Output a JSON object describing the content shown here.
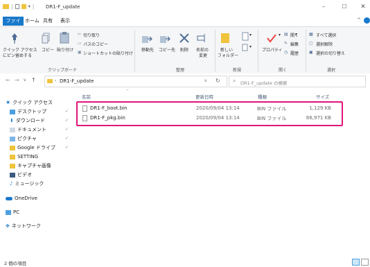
{
  "window": {
    "title": "DR1-F_update"
  },
  "ribbon_tabs": [
    "ファイル",
    "ホーム",
    "共有",
    "表示"
  ],
  "ribbon": {
    "clipboard": {
      "pin_label_1": "クイック アクセス",
      "pin_label_2": "にピン留めする",
      "copy": "コピー",
      "paste": "貼り付け",
      "cut": "切り取り",
      "copy_path": "パスのコピー",
      "paste_shortcut": "ショートカットの貼り付け",
      "group": "クリップボード"
    },
    "organize": {
      "move_to": "移動先",
      "copy_to": "コピー先",
      "delete": "削除",
      "rename_1": "名前の",
      "rename_2": "変更",
      "group": "整理"
    },
    "new": {
      "new_folder_1": "新しい",
      "new_folder_2": "フォルダー",
      "group": "新規"
    },
    "open": {
      "properties": "プロパティ",
      "open": "開く",
      "edit": "編集",
      "history": "履歴",
      "group": "開く"
    },
    "select": {
      "select_all": "すべて選択",
      "select_none": "選択解除",
      "invert": "選択の切り替え",
      "group": "選択"
    }
  },
  "address": {
    "path": "DR1-F_update",
    "search_placeholder": "DR1-F_update の検索"
  },
  "columns": {
    "name": "名前",
    "date": "更新日時",
    "type": "種類",
    "size": "サイズ"
  },
  "files": [
    {
      "name": "DR1-F_boot.bin",
      "date": "2020/09/04 13:14",
      "type": "BIN ファイル",
      "size": "1,129 KB"
    },
    {
      "name": "DR1-F_pkg.bin",
      "date": "2020/09/04 13:14",
      "type": "BIN ファイル",
      "size": "66,971 KB"
    }
  ],
  "nav": {
    "quick_access": "クイック アクセス",
    "desktop": "デスクトップ",
    "downloads": "ダウンロード",
    "documents": "ドキュメント",
    "pictures": "ピクチャ",
    "google_drive": "Google ドライブ",
    "setting": "SETTING",
    "capture": "キャプチャ画像",
    "videos": "ビデオ",
    "music": "ミュージック",
    "onedrive": "OneDrive",
    "pc": "PC",
    "network": "ネットワーク"
  },
  "status": {
    "item_count": "2 個の項目"
  },
  "colors": {
    "accent": "#1979ca",
    "highlight": "#e0147a",
    "folder": "#f0c33c"
  }
}
